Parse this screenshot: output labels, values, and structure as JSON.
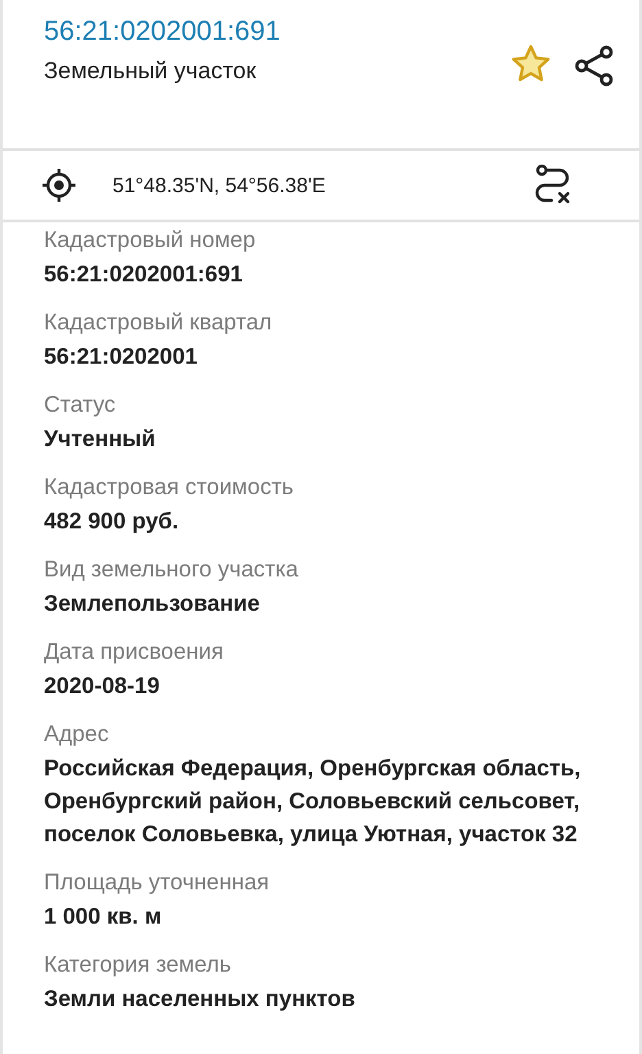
{
  "header": {
    "title": "56:21:0202001:691",
    "subtitle": "Земельный участок"
  },
  "coordinates": "51°48.35'N, 54°56.38'E",
  "fields": [
    {
      "label": "Кадастровый номер",
      "value": "56:21:0202001:691"
    },
    {
      "label": "Кадастровый квартал",
      "value": "56:21:0202001"
    },
    {
      "label": "Статус",
      "value": "Учтенный"
    },
    {
      "label": "Кадастровая стоимость",
      "value": "482 900 руб."
    },
    {
      "label": "Вид земельного участка",
      "value": "Землепользование"
    },
    {
      "label": "Дата присвоения",
      "value": "2020-08-19"
    },
    {
      "label": "Адрес",
      "value": "Российская Федерация, Оренбургская область, Оренбургский район, Соловьевский сельсовет, поселок Соловьевка, улица Уютная, участок 32"
    },
    {
      "label": "Площадь уточненная",
      "value": "1 000 кв. м"
    },
    {
      "label": "Категория земель",
      "value": "Земли населенных пунктов"
    }
  ]
}
